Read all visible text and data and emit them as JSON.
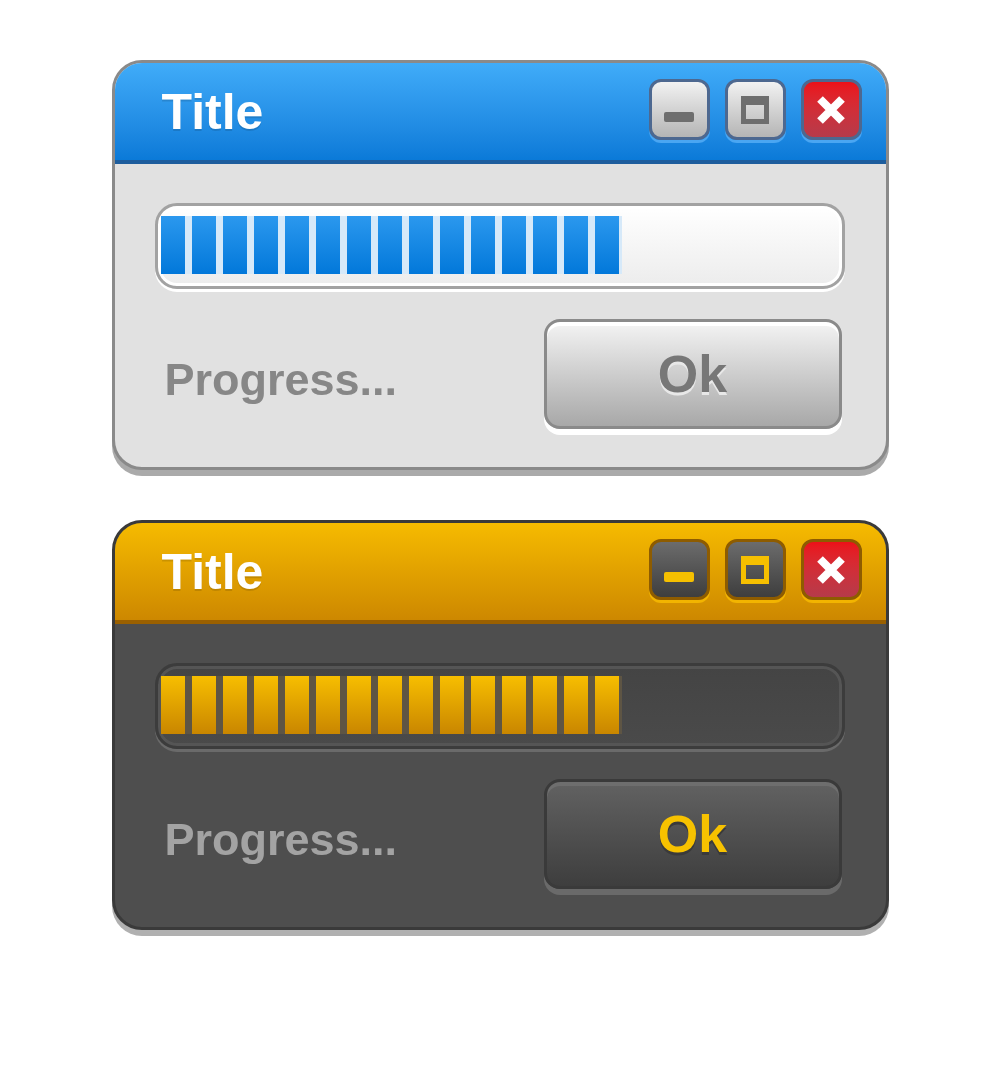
{
  "windows": [
    {
      "kind": "light",
      "title": "Title",
      "progress": {
        "level": 0.68
      },
      "status": "Progress...",
      "button": "Ok"
    },
    {
      "kind": "dark",
      "title": "Title",
      "progress": {
        "level": 0.68
      },
      "status": "Progress...",
      "button": "Ok"
    }
  ]
}
